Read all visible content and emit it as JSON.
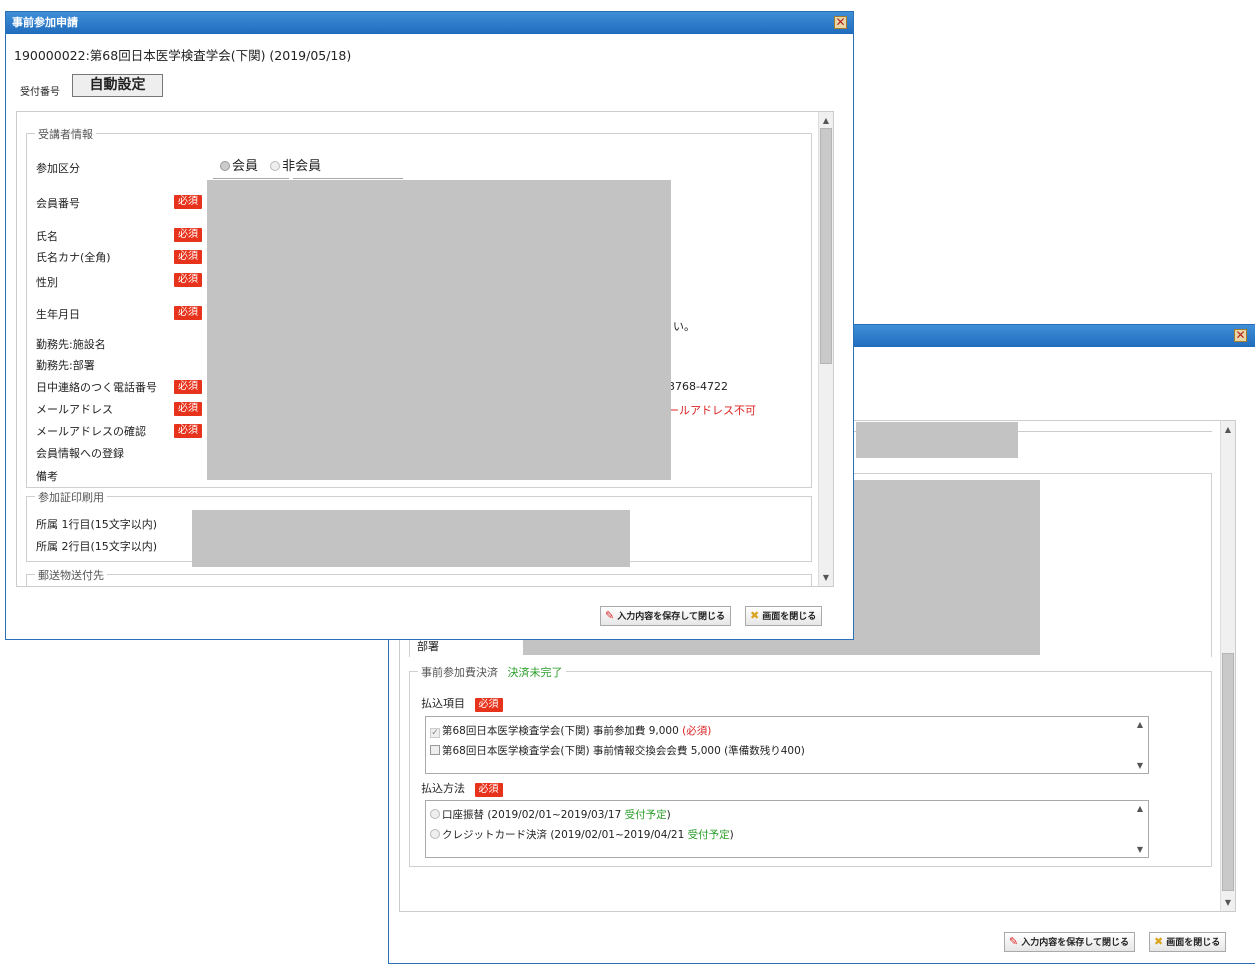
{
  "back_window": {
    "sections": {
      "office_dept_label": "部署",
      "payment_section": "事前参加費決済",
      "payment_status": "決済未完了"
    },
    "payment_items": {
      "label": "払込項目",
      "required": "必須",
      "items": [
        {
          "text": "第68回日本医学検査学会(下関) 事前参加費 9,000",
          "suffix": "(必須)",
          "checked": true
        },
        {
          "text": "第68回日本医学検査学会(下関) 事前情報交換会会費 5,000 (準備数残り400)",
          "suffix": "",
          "checked": false
        }
      ]
    },
    "payment_method": {
      "label": "払込方法",
      "required": "必須",
      "items": [
        {
          "text": "口座振替 (2019/02/01~2019/03/17",
          "status": "受付予定",
          "tail": ")"
        },
        {
          "text": "クレジットカード決済 (2019/02/01~2019/04/21",
          "status": "受付予定",
          "tail": ")"
        }
      ]
    },
    "buttons": {
      "save_close": "入力内容を保存して閉じる",
      "close": "画面を閉じる"
    }
  },
  "front_window": {
    "title": "事前参加申請",
    "event_heading": "190000022:第68回日本医学検査学会(下関) (2019/05/18)",
    "receipt_label": "受付番号",
    "receipt_value": "自動設定",
    "section_attendee": "受講者情報",
    "participation_label": "参加区分",
    "member_option": "会員",
    "nonmember_option": "非会員",
    "required": "必須",
    "fields": {
      "member_no": "会員番号",
      "name": "氏名",
      "name_kana": "氏名カナ(全角)",
      "gender": "性別",
      "birthdate": "生年月日",
      "workplace_facility": "勤務先:施設名",
      "workplace_dept": "勤務先:部署",
      "daytime_phone": "日中連絡のつく電話番号",
      "email": "メールアドレス",
      "email_confirm": "メールアドレスの確認",
      "register_member_info": "会員情報への登録",
      "remarks": "備考"
    },
    "partial_texts": {
      "birthdate_tail": "い。",
      "phone_example": "3768-4722",
      "email_note": "ールアドレス不可"
    },
    "section_badge": "参加証印刷用",
    "affil1": "所属 1行目(15文字以内)",
    "affil2": "所属 2行目(15文字以内)",
    "section_mail": "郵送物送付先",
    "buttons": {
      "save_close": "入力内容を保存して閉じる",
      "close": "画面を閉じる"
    }
  }
}
